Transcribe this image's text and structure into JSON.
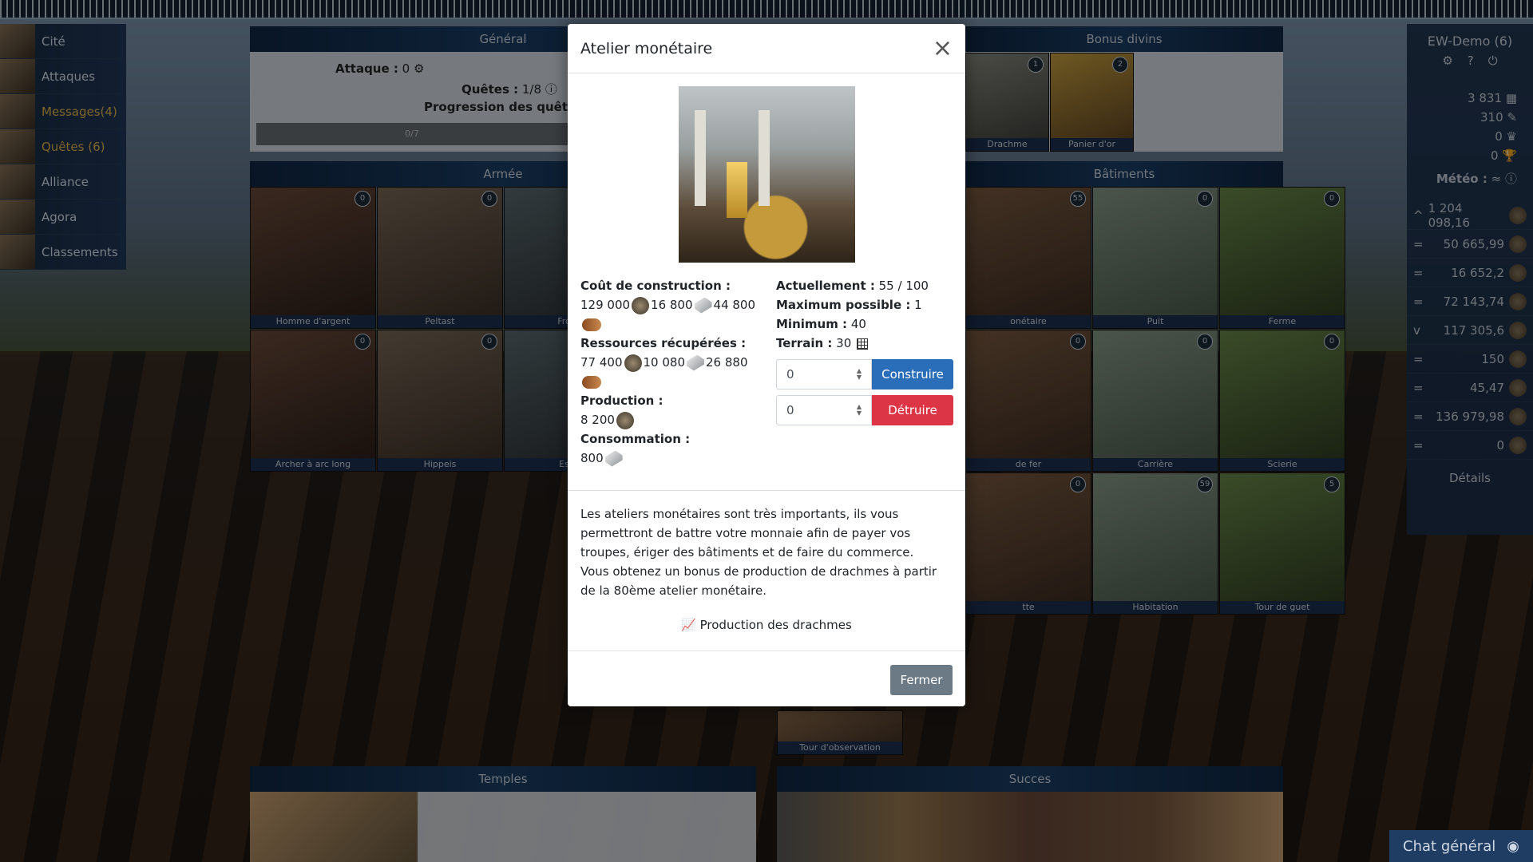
{
  "nav": [
    {
      "label": "Cité",
      "gold": false
    },
    {
      "label": "Attaques",
      "gold": false
    },
    {
      "label": "Messages(4)",
      "gold": true
    },
    {
      "label": "Quêtes (6)",
      "gold": true
    },
    {
      "label": "Alliance",
      "gold": false
    },
    {
      "label": "Agora",
      "gold": false
    },
    {
      "label": "Classements",
      "gold": false
    }
  ],
  "panels": {
    "general": "Général",
    "armee": "Armée",
    "bonus": "Bonus divins",
    "batiments": "Bâtiments",
    "temples": "Temples",
    "succes": "Succes"
  },
  "general": {
    "attaque": "Attaque :",
    "attaque_val": "0",
    "quetes": "Quêtes :",
    "quetes_val": "1/8",
    "progression": "Progression des quêtes :",
    "progress_text": "0/7",
    "progress_fraction": 0
  },
  "armee_cards": [
    {
      "label": "Homme d'argent",
      "count": "0"
    },
    {
      "label": "Peltast",
      "count": "0"
    },
    {
      "label": "Fron",
      "count": ""
    },
    {
      "label": "Archer à arc long",
      "count": "0"
    },
    {
      "label": "Hippeis",
      "count": "0"
    },
    {
      "label": "Esp",
      "count": ""
    }
  ],
  "bonus_cards": [
    {
      "label": "Drachme",
      "count": "1"
    },
    {
      "label": "Panier d'or",
      "count": "2"
    }
  ],
  "bat_cards": [
    {
      "label": "onétaire",
      "count": "55"
    },
    {
      "label": "Puit",
      "count": "0"
    },
    {
      "label": "Ferme",
      "count": "0"
    },
    {
      "label": "de fer",
      "count": "0"
    },
    {
      "label": "Carrière",
      "count": "0"
    },
    {
      "label": "Scierie",
      "count": "0"
    },
    {
      "label": "tte",
      "count": "0"
    },
    {
      "label": "Habitation",
      "count": "59"
    },
    {
      "label": "Tour de guet",
      "count": "5"
    },
    {
      "label": "Tour d'observation",
      "count": ""
    }
  ],
  "right": {
    "user": "EW-Demo (6)",
    "stats": [
      {
        "val": "3 831"
      },
      {
        "val": "310"
      },
      {
        "val": "0"
      },
      {
        "val": "0"
      }
    ],
    "meteo": "Météo :",
    "resources": [
      {
        "ind": "^",
        "val": "1 204 098,16"
      },
      {
        "ind": "=",
        "val": "50 665,99"
      },
      {
        "ind": "=",
        "val": "16 652,2"
      },
      {
        "ind": "=",
        "val": "72 143,74"
      },
      {
        "ind": "v",
        "val": "117 305,6"
      },
      {
        "ind": "=",
        "val": "150"
      },
      {
        "ind": "=",
        "val": "45,47"
      },
      {
        "ind": "=",
        "val": "136 979,98"
      },
      {
        "ind": "=",
        "val": "0"
      }
    ],
    "details": "Détails"
  },
  "modal": {
    "title": "Atelier monétaire",
    "cost_label": "Coût de construction :",
    "cost": {
      "coin": "129 000",
      "iron": "16 800",
      "stone": "44 800"
    },
    "recup_label": "Ressources récupérées :",
    "recup": {
      "coin": "77 400",
      "iron": "10 080",
      "stone": "26 880"
    },
    "prod_label": "Production :",
    "prod": "8 200",
    "conso_label": "Consommation :",
    "conso": "800",
    "actuel_label": "Actuellement :",
    "actuel": "55 / 100",
    "max_label": "Maximum possible :",
    "max": "1",
    "min_label": "Minimum :",
    "min": "40",
    "terrain_label": "Terrain :",
    "terrain": "30",
    "build_value": "0",
    "build_btn": "Construire",
    "destroy_value": "0",
    "destroy_btn": "Détruire",
    "desc1": "Les ateliers monétaires sont très importants, ils vous permettront de battre votre monnaie afin de payer vos troupes, ériger des bâtiments et de faire du commerce.",
    "desc2": "Vous obtenez un bonus de production de drachmes à partir de la 80ème atelier monétaire.",
    "chart_link": "Production des drachmes",
    "close_btn": "Fermer"
  },
  "chat": "Chat général"
}
